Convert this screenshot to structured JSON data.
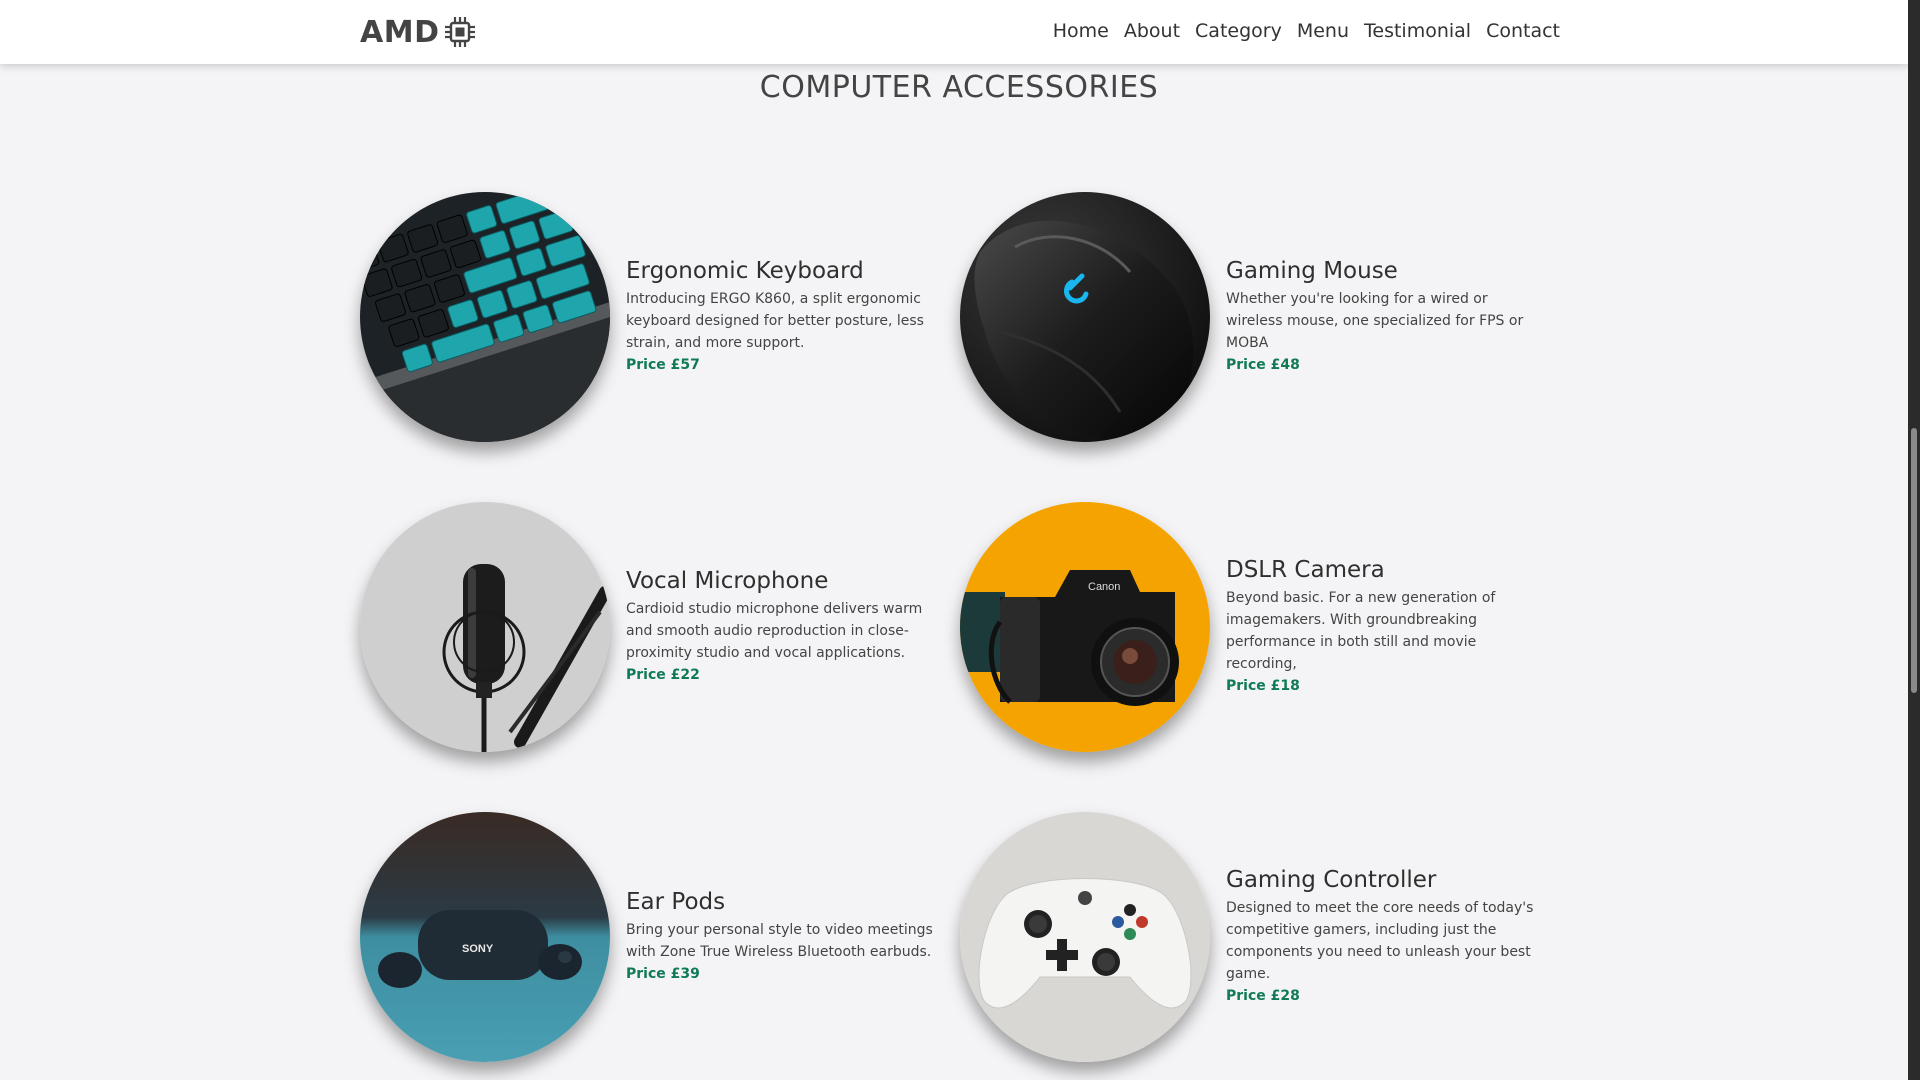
{
  "header": {
    "logo_text": "AMD",
    "logo_icon": "cpu-chip-icon",
    "nav": [
      "Home",
      "About",
      "Category",
      "Menu",
      "Testimonial",
      "Contact"
    ]
  },
  "section": {
    "title": "COMPUTER ACCESSORIES"
  },
  "products": [
    {
      "title": "Ergonomic Keyboard",
      "description": "Introducing ERGO K860, a split ergonomic keyboard designed for better posture, less strain, and more support.",
      "price": "Price £57",
      "image": "keyboard-photo"
    },
    {
      "title": "Gaming Mouse",
      "description": "Whether you're looking for a wired or wireless mouse, one specialized for FPS or MOBA",
      "price": "Price £48",
      "image": "mouse-photo"
    },
    {
      "title": "Vocal Microphone",
      "description": "Cardioid studio microphone delivers warm and smooth audio reproduction in close-proximity studio and vocal applications.",
      "price": "Price £22",
      "image": "microphone-photo"
    },
    {
      "title": "DSLR Camera",
      "description": "Beyond basic. For a new generation of imagemakers. With groundbreaking performance in both still and movie recording,",
      "price": "Price £18",
      "image": "camera-photo"
    },
    {
      "title": "Ear Pods",
      "description": "Bring your personal style to video meetings with Zone True Wireless Bluetooth earbuds.",
      "price": "Price £39",
      "image": "earbuds-photo"
    },
    {
      "title": "Gaming Controller",
      "description": "Designed to meet the core needs of today's competitive gamers, including just the components you need to unleash your best game.",
      "price": "Price £28",
      "image": "controller-photo"
    }
  ],
  "photo_text": {
    "camera_brand": "Canon",
    "earbuds_brand": "SONY"
  },
  "colors": {
    "price": "#0f7a55",
    "background": "#f4f4f6",
    "camera_backdrop": "#f5a300",
    "keyboard_accent": "#1fa6ad",
    "mouse_logo": "#19b6f0"
  }
}
